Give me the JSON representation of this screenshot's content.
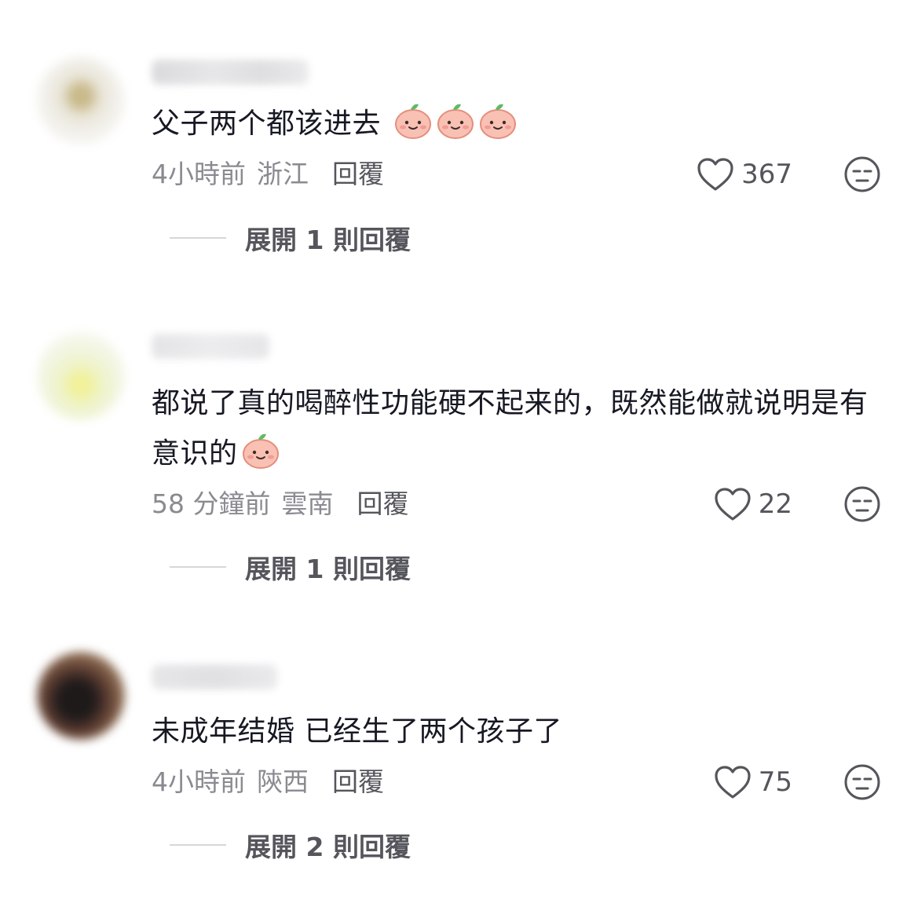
{
  "comments": [
    {
      "text": "父子两个都该进去",
      "emoji_count": 3,
      "time": "4小時前",
      "location": "浙江",
      "reply_label": "回覆",
      "likes": "367",
      "expand_label": "展開 1 則回覆"
    },
    {
      "text": "都说了真的喝醉性功能硬不起来的，既然能做就说明是有意识的",
      "emoji_count": 1,
      "time": "58 分鐘前",
      "location": "雲南",
      "reply_label": "回覆",
      "likes": "22",
      "expand_label": "展開 1 則回覆"
    },
    {
      "text": "未成年结婚 已经生了两个孩子了",
      "emoji_count": 0,
      "time": "4小時前",
      "location": "陝西",
      "reply_label": "回覆",
      "likes": "75",
      "expand_label": "展開 2 則回覆"
    }
  ],
  "icons": {
    "like": "heart-outline-icon",
    "dislike": "meh-face-icon",
    "emoji": "peach-smile-emoji"
  },
  "colors": {
    "text": "#161823",
    "meta": "#8a8b91",
    "action": "#55565c",
    "peach": "#f7b6a8"
  }
}
